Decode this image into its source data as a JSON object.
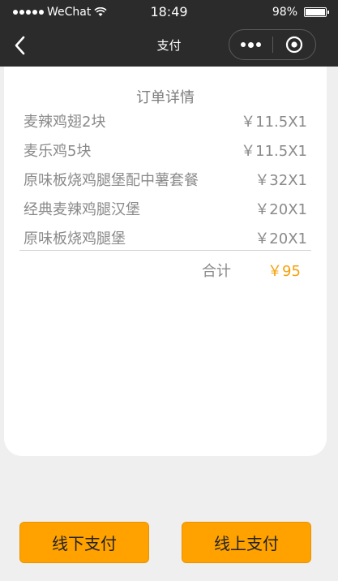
{
  "status_bar": {
    "carrier": "WeChat",
    "time": "18:49",
    "battery": "98%",
    "battery_level": 0.98
  },
  "nav": {
    "title": "支付"
  },
  "order": {
    "title": "订单详情",
    "items": [
      {
        "name": "麦辣鸡翅2块",
        "price": "￥11.5X1"
      },
      {
        "name": "麦乐鸡5块",
        "price": "￥11.5X1"
      },
      {
        "name": "原味板烧鸡腿堡配中薯套餐",
        "price": "￥32X1"
      },
      {
        "name": "经典麦辣鸡腿汉堡",
        "price": "￥20X1"
      },
      {
        "name": "原味板烧鸡腿堡",
        "price": "￥20X1"
      }
    ],
    "total_label": "合计",
    "total_value": "￥95"
  },
  "buttons": {
    "offline": "线下支付",
    "online": "线上支付"
  },
  "colors": {
    "accent": "#ffa200",
    "total": "#f5a10c",
    "navbar": "#2b2b2b"
  }
}
